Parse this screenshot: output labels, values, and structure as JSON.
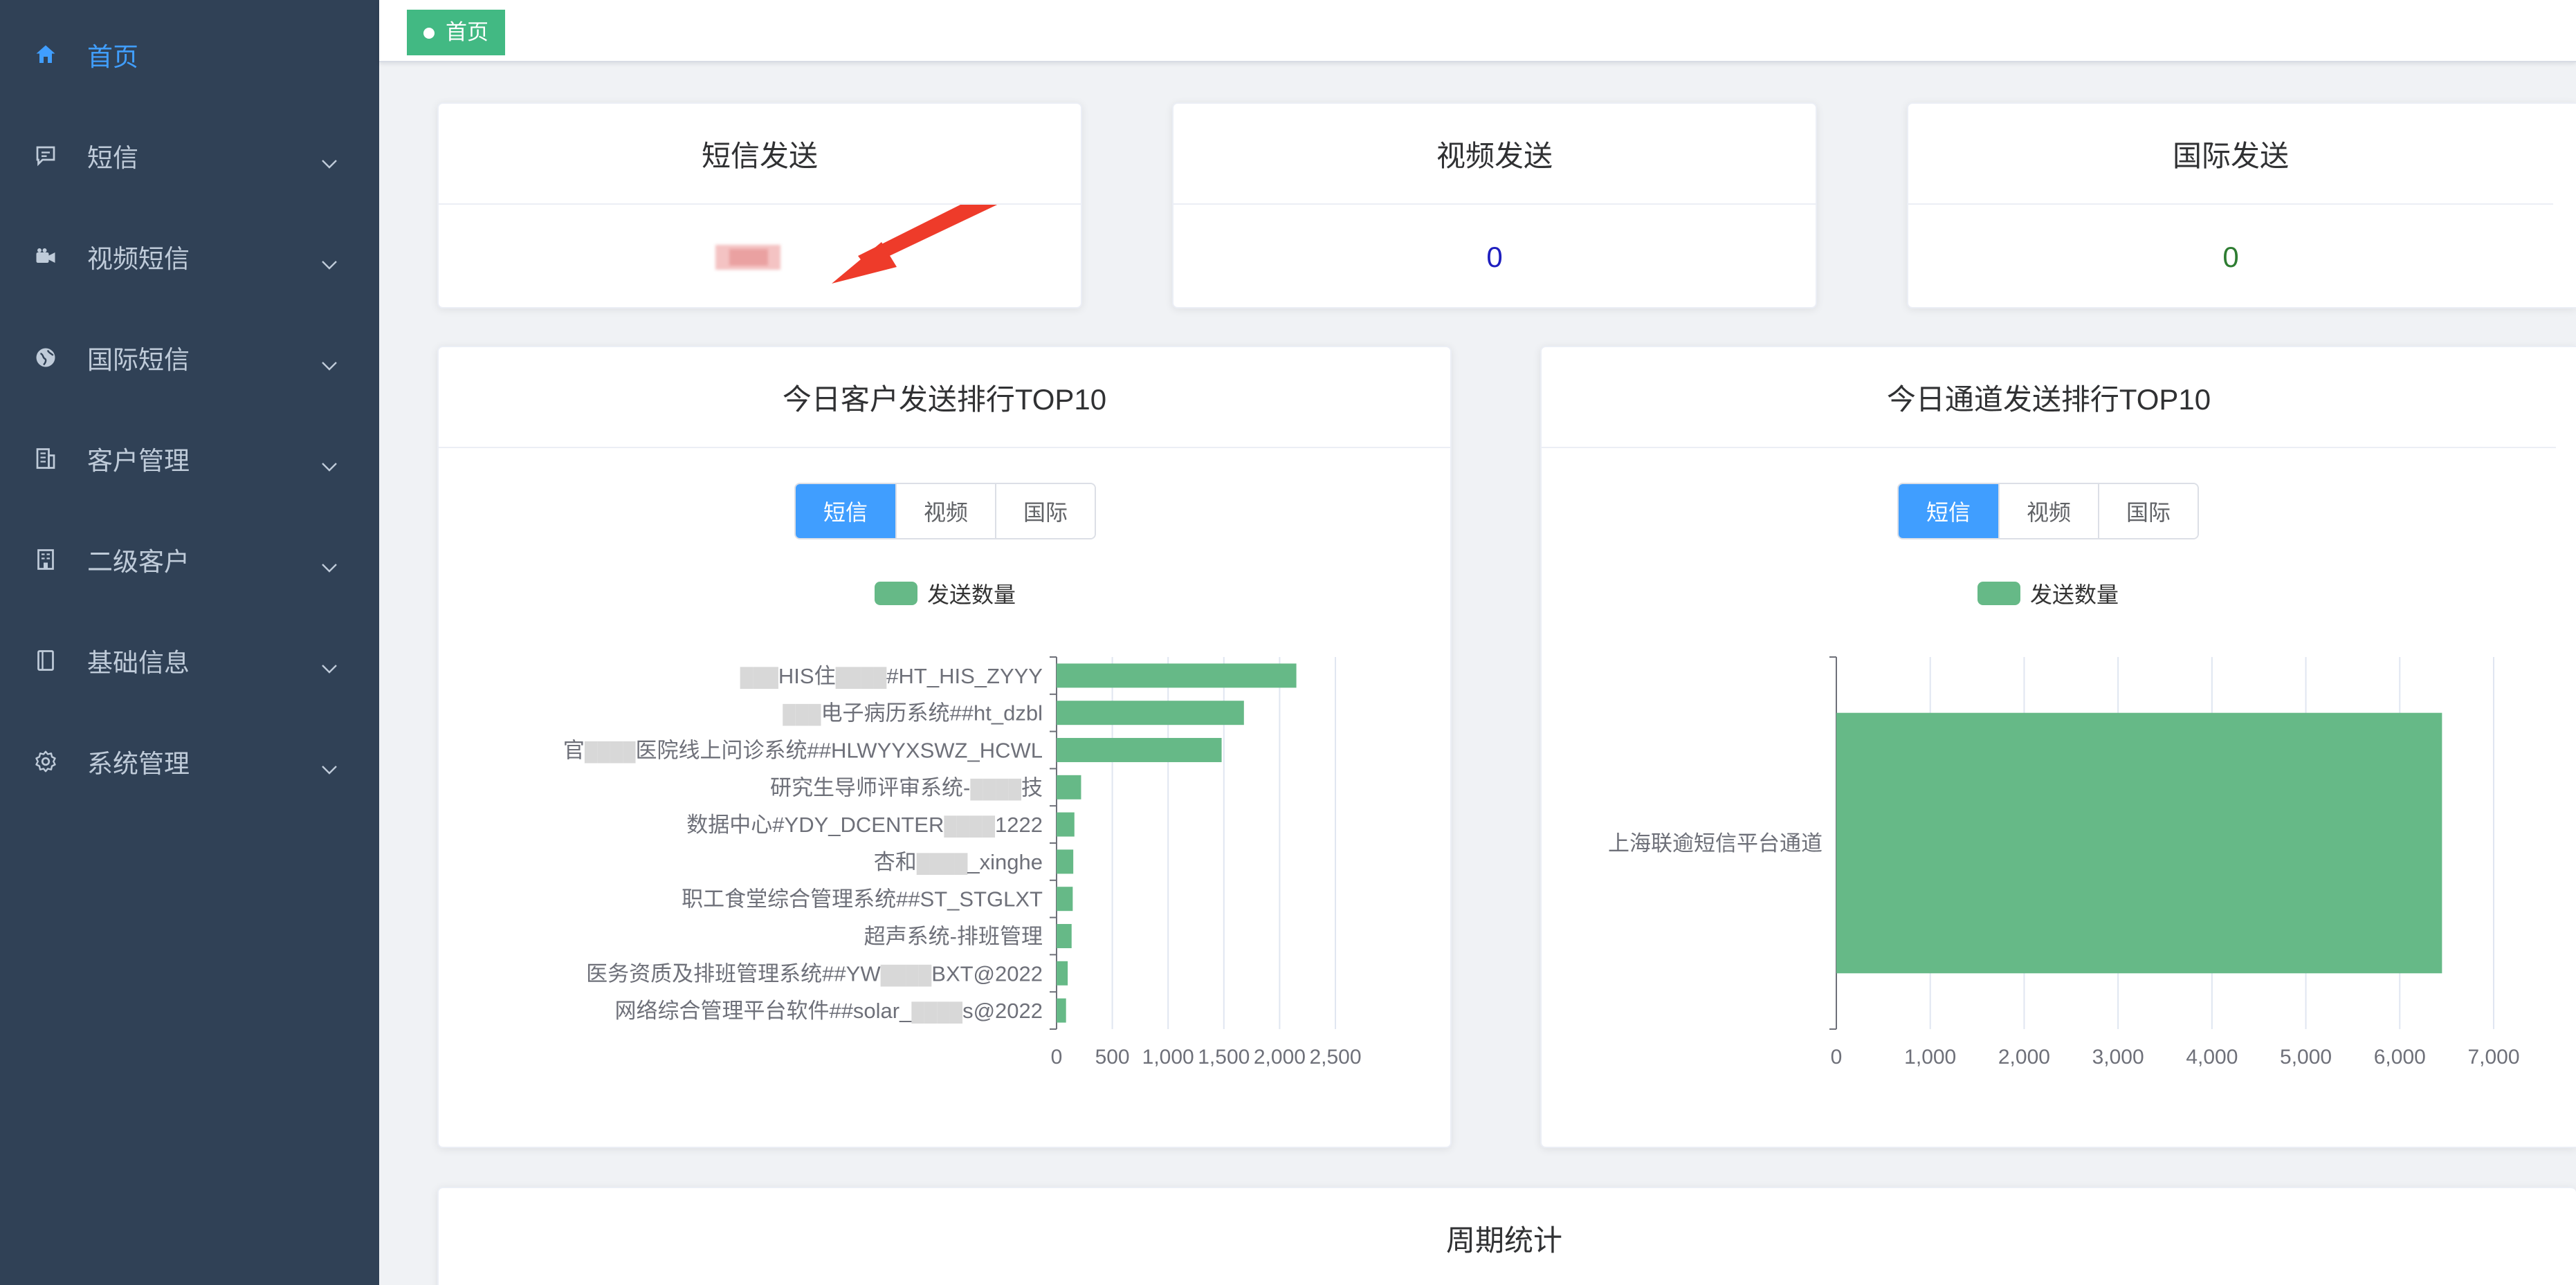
{
  "sidebar": {
    "items": [
      {
        "label": "首页",
        "icon": "home-icon",
        "active": true,
        "has_children": false
      },
      {
        "label": "短信",
        "icon": "message-icon",
        "active": false,
        "has_children": true
      },
      {
        "label": "视频短信",
        "icon": "video-camera-icon",
        "active": false,
        "has_children": true
      },
      {
        "label": "国际短信",
        "icon": "globe-icon",
        "active": false,
        "has_children": true
      },
      {
        "label": "客户管理",
        "icon": "building-icon",
        "active": false,
        "has_children": true
      },
      {
        "label": "二级客户",
        "icon": "office-icon",
        "active": false,
        "has_children": true
      },
      {
        "label": "基础信息",
        "icon": "notebook-icon",
        "active": false,
        "has_children": true
      },
      {
        "label": "系统管理",
        "icon": "gear-icon",
        "active": false,
        "has_children": true
      }
    ]
  },
  "tags": {
    "active_label": "首页"
  },
  "stats": [
    {
      "title": "短信发送",
      "value": "",
      "value_color": "#f56c6c"
    },
    {
      "title": "视频发送",
      "value": "0",
      "value_color": "#1f1fbf"
    },
    {
      "title": "国际发送",
      "value": "0",
      "value_color": "#2e7d32"
    }
  ],
  "customer_rank": {
    "title": "今日客户发送排行TOP10",
    "tabs": [
      "短信",
      "视频",
      "国际"
    ],
    "active_tab": "短信"
  },
  "channel_rank": {
    "title": "今日通道发送排行TOP10",
    "tabs": [
      "短信",
      "视频",
      "国际"
    ],
    "active_tab": "短信"
  },
  "period": {
    "title": "周期统计"
  },
  "colors": {
    "sidebar_bg": "#304156",
    "accent": "#409eff",
    "tag_green": "#42b983",
    "bar_green": "#66b987"
  },
  "chart_data": [
    {
      "type": "bar",
      "orientation": "horizontal",
      "title": "今日客户发送排行TOP10",
      "legend": [
        "发送数量"
      ],
      "legend_position": "top-center",
      "categories": [
        "HIS住院系统##HT_HIS_ZYYY",
        "电子病历系统##ht_dzbl",
        "医院线上问诊系统##HLWYYXSWZ_HCWL",
        "研究生导师评审系统",
        "数据中心#YDY_DCENTER@1222",
        "杏和_xinghe",
        "职工食堂综合管理系统##ST_STGLXT",
        "超声系统-排班管理",
        "医务资质及排班管理系统##YWBXT@2022",
        "网络综合管理平台软件##solar_s@2022"
      ],
      "category_display": [
        {
          "visible": "HIS住",
          "mid_blur": true,
          "tail": "#HT_HIS_ZYYY",
          "lead_blur": true
        },
        {
          "visible": "",
          "mid_blur": false,
          "tail": "电子病历系统##ht_dzbl",
          "lead_blur": true
        },
        {
          "visible": "官",
          "mid_blur": true,
          "tail": "医院线上问诊系统##HLWYYXSWZ_HCWL",
          "lead_blur": false
        },
        {
          "visible": "研究生导师评审系统-",
          "mid_blur": true,
          "tail": "技",
          "lead_blur": false
        },
        {
          "visible": "数据中心#YDY_DCENTER",
          "mid_blur": true,
          "tail": "1222",
          "lead_blur": false
        },
        {
          "visible": "杏和",
          "mid_blur": true,
          "tail": "_xinghe",
          "lead_blur": false
        },
        {
          "visible": "",
          "mid_blur": false,
          "tail": "职工食堂综合管理系统##ST_STGLXT",
          "lead_blur": false
        },
        {
          "visible": "",
          "mid_blur": false,
          "tail": "超声系统-排班管理",
          "lead_blur": false
        },
        {
          "visible": "医务资质及排班管理系统##YW",
          "mid_blur": true,
          "tail": "BXT@2022",
          "lead_blur": false
        },
        {
          "visible": "网络综合管理平台软件##solar_",
          "mid_blur": true,
          "tail": "s@2022",
          "lead_blur": false
        }
      ],
      "values": [
        2150,
        1680,
        1480,
        220,
        160,
        150,
        145,
        135,
        100,
        85
      ],
      "xlim": [
        0,
        2500
      ],
      "xticks": [
        "0",
        "500",
        "1,000",
        "1,500",
        "2,000",
        "2,500"
      ],
      "grid": true
    },
    {
      "type": "bar",
      "orientation": "horizontal",
      "title": "今日通道发送排行TOP10",
      "legend": [
        "发送数量"
      ],
      "legend_position": "top-center",
      "categories": [
        "上海联逾短信平台通道"
      ],
      "values": [
        6450
      ],
      "xlim": [
        0,
        7000
      ],
      "xticks": [
        "0",
        "1,000",
        "2,000",
        "3,000",
        "4,000",
        "5,000",
        "6,000",
        "7,000"
      ],
      "grid": true
    }
  ]
}
